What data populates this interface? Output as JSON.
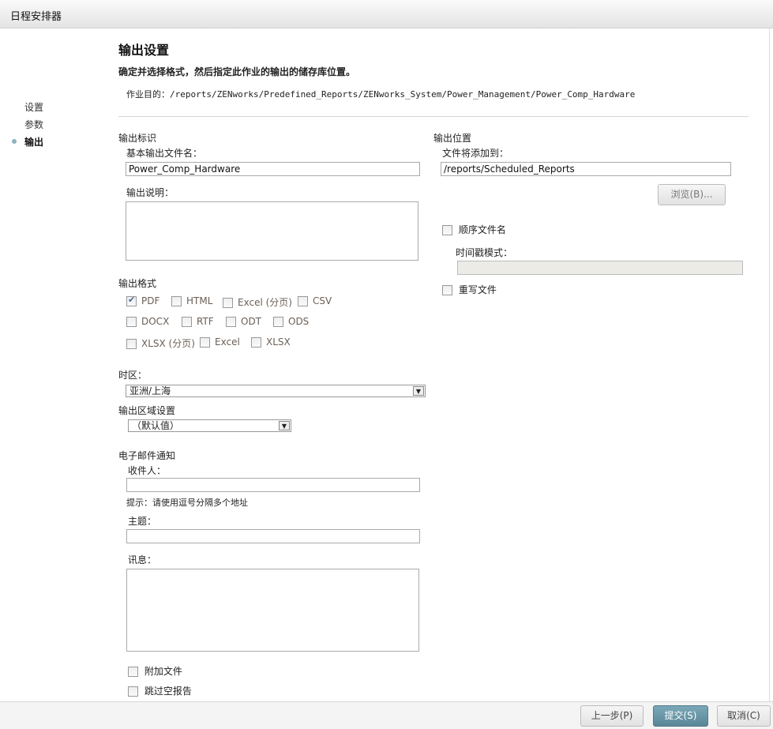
{
  "window": {
    "title": "日程安排器"
  },
  "nav": {
    "items": [
      {
        "label": "设置"
      },
      {
        "label": "参数"
      },
      {
        "label": "输出"
      }
    ]
  },
  "header": {
    "title": "输出设置",
    "description": "确定并选择格式，然后指定此作业的输出的储存库位置。",
    "target": "作业目的：/reports/ZENworks/Predefined_Reports/ZENworks_System/Power_Management/Power_Comp_Hardware"
  },
  "output_id": {
    "section": "输出标识",
    "filename_label": "基本输出文件名：",
    "filename_value": "Power_Comp_Hardware",
    "desc_label": "输出说明："
  },
  "output_format": {
    "section": "输出格式",
    "formats": [
      {
        "label": "PDF",
        "checked": true
      },
      {
        "label": "HTML",
        "checked": false
      },
      {
        "label": "Excel (分页)",
        "checked": false
      },
      {
        "label": "CSV",
        "checked": false
      },
      {
        "label": "DOCX",
        "checked": false
      },
      {
        "label": "RTF",
        "checked": false
      },
      {
        "label": "ODT",
        "checked": false
      },
      {
        "label": "ODS",
        "checked": false
      },
      {
        "label": "XLSX (分页)",
        "checked": false
      },
      {
        "label": "Excel",
        "checked": false
      },
      {
        "label": "XLSX",
        "checked": false
      }
    ]
  },
  "timezone": {
    "label": "时区：",
    "value": "亚洲/上海"
  },
  "locale": {
    "label": "输出区域设置",
    "value": "（默认值）"
  },
  "email": {
    "section": "电子邮件通知",
    "to_label": "收件人：",
    "hint": "提示：请使用逗号分隔多个地址",
    "subject_label": "主题：",
    "message_label": "讯息：",
    "attach_label": "附加文件",
    "skip_label": "跳过空报告"
  },
  "output_location": {
    "section": "输出位置",
    "folder_label": "文件将添加到：",
    "folder_value": "/reports/Scheduled_Reports",
    "browse_label": "浏览(B)...",
    "sequential_label": "顺序文件名",
    "timestamp_label": "时间戳模式：",
    "overwrite_label": "重写文件"
  },
  "footer": {
    "back_label": "上一步(P)",
    "submit_label": "提交(S)",
    "cancel_label": "取消(C)"
  },
  "colors": {
    "accent": "#6a98a8"
  }
}
